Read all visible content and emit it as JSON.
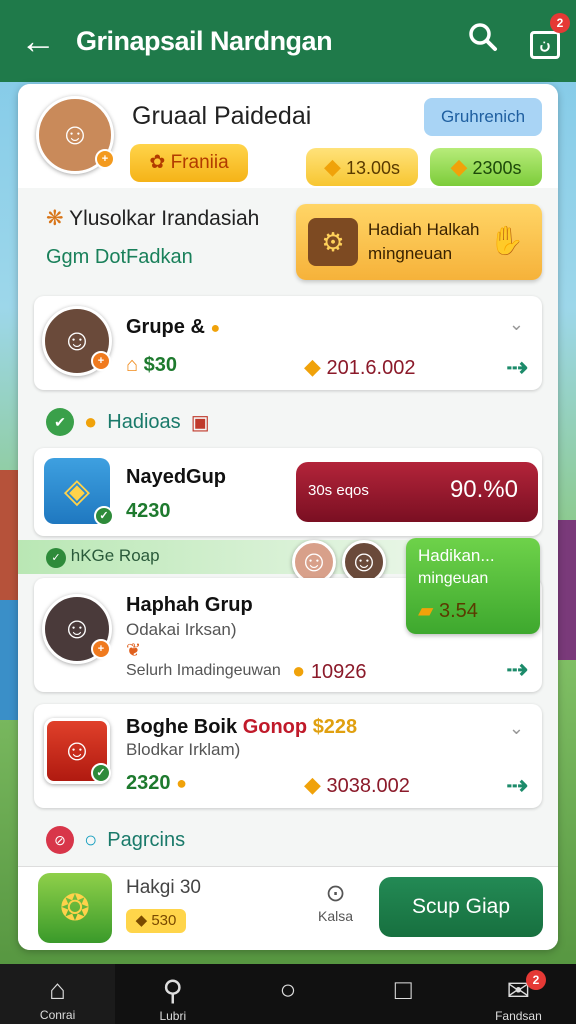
{
  "appbar": {
    "title": "Grinapsail Nardngan",
    "notif_count": "2"
  },
  "profile": {
    "name": "Gruaal Paidedai",
    "badge": "Gruhrenich",
    "rank": "Franiia",
    "coins_gold": "13.00s",
    "coins_green": "2300s"
  },
  "weekly": {
    "title": "Ylusolkar Irandasiah",
    "subtitle": "Ggm DotFadkan",
    "reward_line1": "Hadiah Halkah",
    "reward_line2": "mingneuan"
  },
  "groups": [
    {
      "title": "Grupe &",
      "value": "$30",
      "amount": "201.6.002"
    },
    {
      "title": "NayedGup",
      "value": "4230",
      "badge_text": "30s eqos",
      "badge_pct": "90.%0"
    },
    {
      "title": "Haphah Grup",
      "sub": "Odakai Irksan)",
      "line": "Selurh Imadingeuwan",
      "amount": "10926"
    },
    {
      "title": "Boghe Boik",
      "title_red": "Gonop",
      "title_gold": "$228",
      "sub": "Blodkar Irklam)",
      "value": "2320",
      "amount": "3038.002"
    }
  ],
  "sections": {
    "hadioas": "Hadioas",
    "banner_label": "hKGe Roap",
    "pagrcins": "Pagrcins"
  },
  "overlay": {
    "line1": "Hadikan...",
    "line2": "mingeuan",
    "value": "3.54"
  },
  "footer": {
    "title": "Hakgi 30",
    "pill": "530",
    "mid_label": "Kalsa",
    "cta": "Scup Giap"
  },
  "navbar": [
    {
      "label": "Conrai",
      "icon": "home-icon"
    },
    {
      "label": "Lubri",
      "icon": "search-icon"
    },
    {
      "label": "",
      "icon": "circle-icon"
    },
    {
      "label": "",
      "icon": "square-icon"
    },
    {
      "label": "Fandsan",
      "icon": "inbox-icon",
      "badge": "2"
    }
  ],
  "colors": {
    "primary": "#1f7a4a",
    "gold": "#f7c631",
    "green": "#7ccc3a",
    "red": "#8b1a2a"
  }
}
